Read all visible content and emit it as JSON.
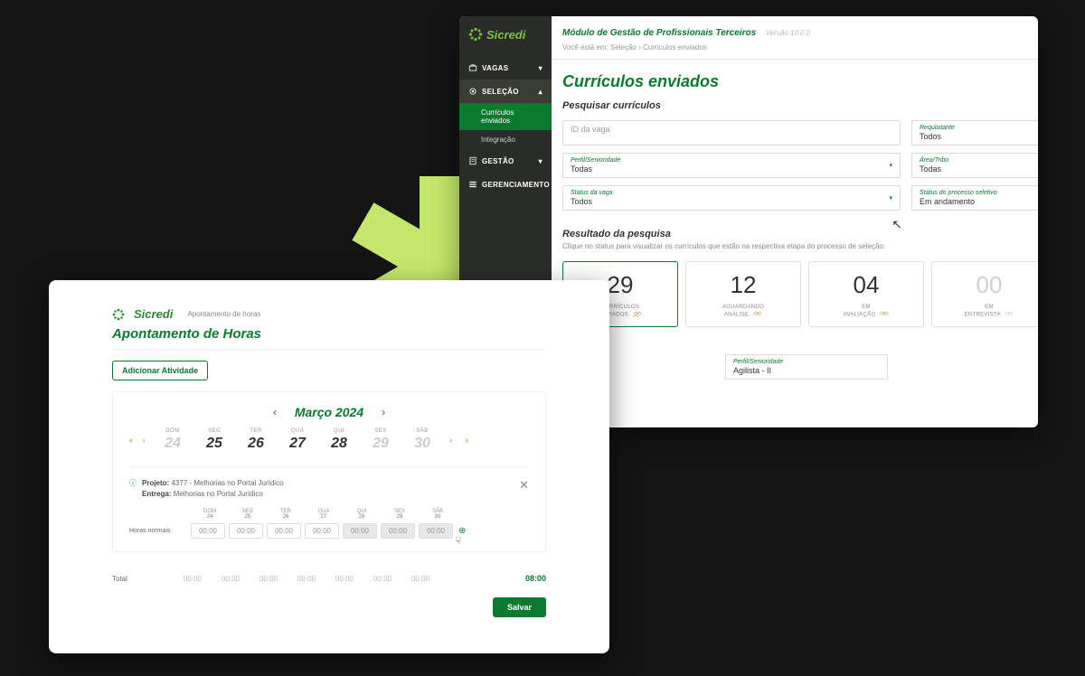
{
  "brand": "Sicredi",
  "back": {
    "module": "Módulo de Gestão de Profissionais Terceiros",
    "version": "Versão 10.0.0",
    "crumb_prefix": "Você está em:",
    "crumb1": "Seleção",
    "crumb2": "Currículos enviados",
    "nav": {
      "vagas": "VAGAS",
      "selecao": "SELEÇÃO",
      "sub_curriculos": "Currículos enviados",
      "sub_integracao": "Integração",
      "gestao": "GESTÃO",
      "gerenciamento": "GERENCIAMENTO"
    },
    "page_title": "Currículos enviados",
    "search": {
      "heading": "Pesquisar currículos",
      "id_vaga_ph": "ID da vaga",
      "requisitante_lbl": "Requisitante",
      "requisitante_val": "Todos",
      "perfil_lbl": "Perfil/Senioridade",
      "perfil_val": "Todas",
      "area_lbl": "Área/Tribo",
      "area_val": "Todas",
      "status_vaga_lbl": "Status da vaga",
      "status_vaga_val": "Todos",
      "status_proc_lbl": "Status do processo seletivo",
      "status_proc_val": "Em andamento"
    },
    "results": {
      "heading": "Resultado da pesquisa",
      "sub": "Clique no status para visualizar os currículos que estão na respectiva etapa do processo de seleção:",
      "cards": [
        {
          "num": "29",
          "l1": "CURRÍCULOS",
          "l2": "ENVIADOS"
        },
        {
          "num": "12",
          "l1": "AGUARDANDO",
          "l2": "ANÁLISE"
        },
        {
          "num": "04",
          "l1": "EM",
          "l2": "AVALIAÇÃO"
        },
        {
          "num": "00",
          "l1": "EM",
          "l2": "ENTREVISTA"
        }
      ],
      "chip_lbl": "Perfil/Senioridade",
      "chip_val": "Agilista - II"
    }
  },
  "front": {
    "crumb": "Apontamento de horas",
    "title": "Apontamento de Horas",
    "add_btn": "Adicionar Atividade",
    "month": "Março 2024",
    "days": [
      {
        "lbl": "DOM",
        "num": "24",
        "dim": true
      },
      {
        "lbl": "SEG",
        "num": "25",
        "dim": false
      },
      {
        "lbl": "TER",
        "num": "26",
        "dim": false
      },
      {
        "lbl": "QUA",
        "num": "27",
        "dim": false
      },
      {
        "lbl": "QUI",
        "num": "28",
        "dim": false
      },
      {
        "lbl": "SEX",
        "num": "29",
        "dim": true
      },
      {
        "lbl": "SÁB",
        "num": "30",
        "dim": true
      }
    ],
    "projeto_lbl": "Projeto:",
    "projeto_val": "4377 - Melhorias no Portal Jurídico",
    "entrega_lbl": "Entrega:",
    "entrega_val": "Melhorias no Portal Jurídico",
    "horas_lbl": "Horas normais",
    "inputs": [
      "00:00",
      "00:00",
      "00:00",
      "00:00",
      "00:00",
      "00:00",
      "00:00"
    ],
    "total_lbl": "Total",
    "totals": [
      "00:00",
      "00:00",
      "00:00",
      "00:00",
      "00:00",
      "00:00",
      "00:00"
    ],
    "grand": "08:00",
    "save": "Salvar"
  }
}
